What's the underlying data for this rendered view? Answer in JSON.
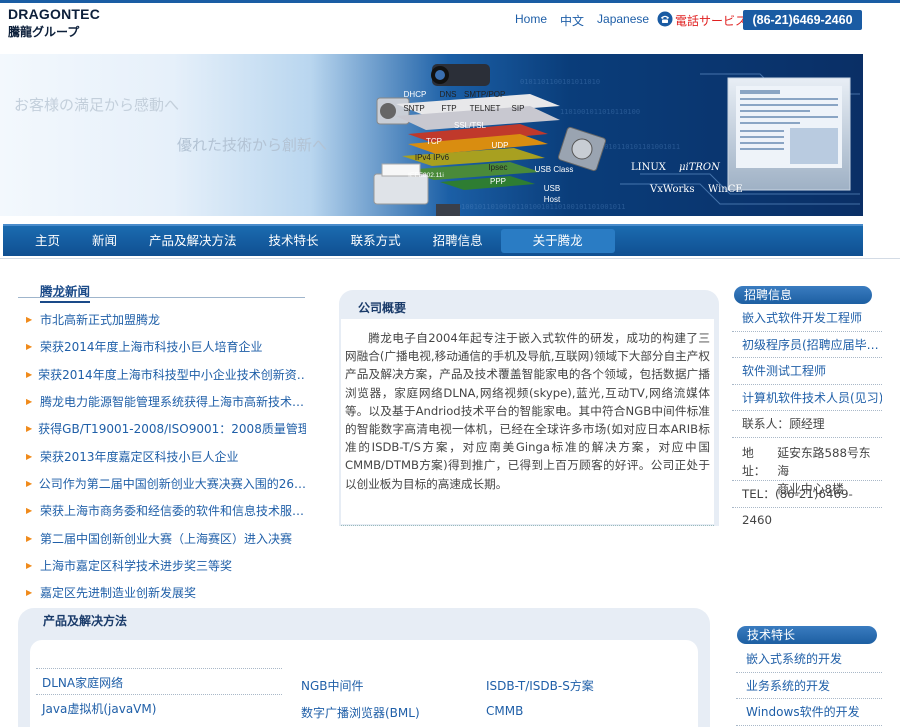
{
  "header": {
    "logo_en": "DRAGONTEC",
    "logo_jp": "騰龍グループ",
    "links": [
      "Home",
      "中文",
      "Japanese"
    ],
    "phone_label": "電話サービス",
    "phone_number": "(86-21)6469-2460"
  },
  "banner": {
    "slogan_1": "お客様の満足から感動へ",
    "slogan_2": "優れた技術から創新へ",
    "protocols": [
      "DHCP",
      "DNS",
      "SMTP/POP",
      "SNTP",
      "FTP",
      "TELNET",
      "SIP",
      "SSL/TSL",
      "TCP",
      "UDP",
      "IPv4 IPv6",
      "IEEE802.11i",
      "Ipsec",
      "PPP",
      "USB Class",
      "USB Host"
    ],
    "tags": [
      "LINUX",
      "μiTRON",
      "VxWorks",
      "WinCE"
    ]
  },
  "nav": {
    "items": [
      "主页",
      "新闻",
      "产品及解决方法",
      "技术特长",
      "联系方式",
      "招聘信息",
      "关于腾龙"
    ],
    "active": "关于腾龙"
  },
  "news": {
    "title": "腾龙新闻",
    "items": [
      "市北高新正式加盟腾龙",
      "荣获2014年度上海市科技小巨人培育企业",
      "荣获2014年度上海市科技型中小企业技术创新资…",
      "腾龙电力能源智能管理系统获得上海市高新技术…",
      "获得GB/T19001-2008/ISO9001：2008质量管理…",
      "荣获2013年度嘉定区科技小巨人企业",
      "公司作为第二届中国创新创业大赛决赛入围的26…",
      "荣获上海市商务委和经信委的软件和信息技术服…",
      "第二届中国创新创业大赛（上海赛区）进入决赛",
      "上海市嘉定区科学技术进步奖三等奖",
      "嘉定区先进制造业创新发展奖"
    ]
  },
  "company": {
    "title": "公司概要",
    "text": "腾龙电子自2004年起专注于嵌入式软件的研发，成功的构建了三网融合(广播电视,移动通信的手机及导航,互联网)领域下大部分自主产权产品及解决方案，产品及技术覆盖智能家电的各个领域，包括数据广播浏览器，家庭网络DLNA,网络视频(skype),蓝光,互动TV,网络流媒体等。以及基于Andriod技术平台的智能家电。其中符合NGB中间件标准的智能数字高清电视一体机，已经在全球许多市场(如对应日本ARIB标准的ISDB-T/S方案，对应南美Ginga标准的解决方案，对应中国CMMB/DTMB方案)得到推广，已得到上百万顾客的好评。公司正处于以创业板为目标的高速成长期。"
  },
  "recruit": {
    "title": "招聘信息",
    "items": [
      "嵌入式软件开发工程师",
      "初级程序员(招聘应届毕…",
      "软件测试工程师",
      "计算机软件技术人员(见习)"
    ],
    "contact_label": "联系人：",
    "contact_name": "顾经理",
    "address_label": "地址：",
    "address_1": "延安东路588号东海",
    "address_2": "商业中心8楼",
    "tel_label": "TEL：",
    "tel_value": "(86-21)6469-2460"
  },
  "products": {
    "title": "产品及解决方法",
    "col1": [
      "DLNA家庭网络",
      "Java虚拟机(javaVM)"
    ],
    "col2": [
      "NGB中间件",
      "数字广播浏览器(BML)"
    ],
    "col3": [
      "ISDB-T/ISDB-S方案",
      "CMMB"
    ]
  },
  "tech": {
    "title": "技术特长",
    "items": [
      "嵌入式系统的开发",
      "业务系统的开发",
      "Windows软件的开发"
    ]
  }
}
